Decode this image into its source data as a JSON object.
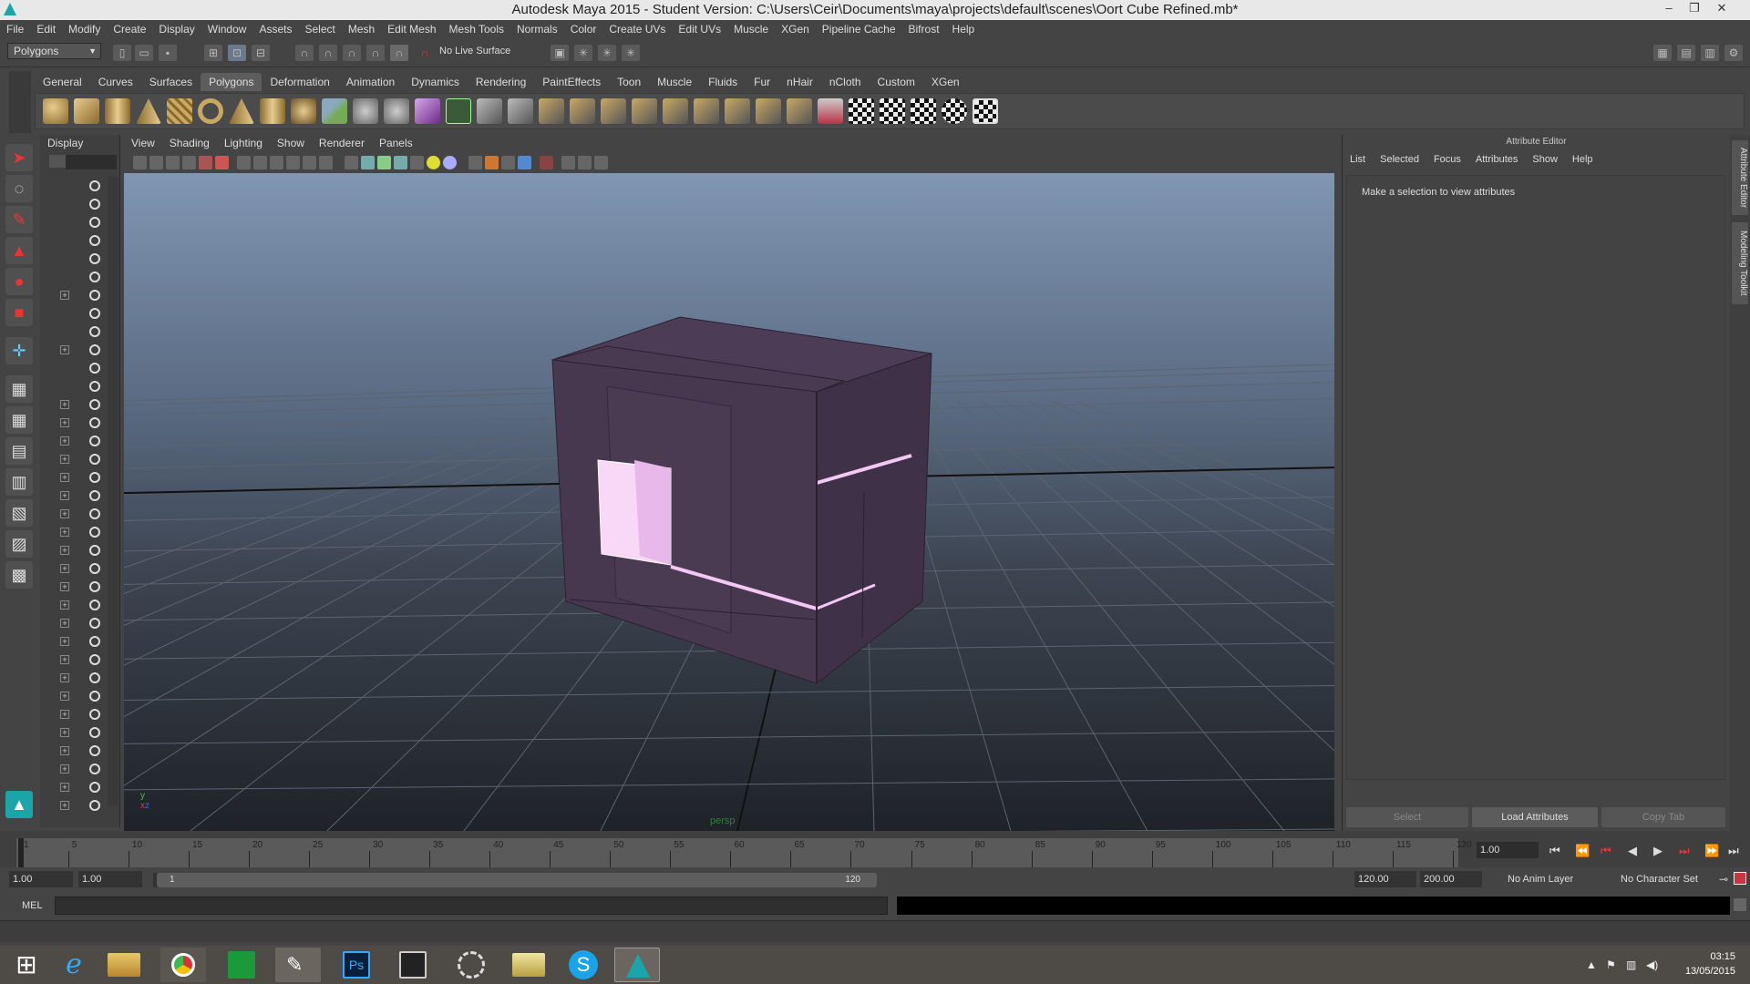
{
  "window": {
    "title": "Autodesk Maya 2015 - Student Version: C:\\Users\\Ceir\\Documents\\maya\\projects\\default\\scenes\\Oort Cube Refined.mb*",
    "minimize": "–",
    "restore": "❐",
    "close": "✕"
  },
  "menubar": [
    "File",
    "Edit",
    "Modify",
    "Create",
    "Display",
    "Window",
    "Assets",
    "Select",
    "Mesh",
    "Edit Mesh",
    "Mesh Tools",
    "Normals",
    "Color",
    "Create UVs",
    "Edit UVs",
    "Muscle",
    "XGen",
    "Pipeline Cache",
    "Bifrost",
    "Help"
  ],
  "status": {
    "mode": "Polygons",
    "live_surface": "No Live Surface"
  },
  "shelf": {
    "tabs": [
      "General",
      "Curves",
      "Surfaces",
      "Polygons",
      "Deformation",
      "Animation",
      "Dynamics",
      "Rendering",
      "PaintEffects",
      "Toon",
      "Muscle",
      "Fluids",
      "Fur",
      "nHair",
      "nCloth",
      "Custom",
      "XGen"
    ],
    "active_tab": "Polygons"
  },
  "outliner": {
    "header": "Display"
  },
  "panel": {
    "menus": [
      "View",
      "Shading",
      "Lighting",
      "Show",
      "Renderer",
      "Panels"
    ],
    "camera_label": "persp"
  },
  "attribute_editor": {
    "title": "Attribute Editor",
    "menus": [
      "List",
      "Selected",
      "Focus",
      "Attributes",
      "Show",
      "Help"
    ],
    "message": "Make a selection to view attributes",
    "buttons": {
      "select": "Select",
      "load": "Load Attributes",
      "copy": "Copy Tab"
    }
  },
  "side_tabs": [
    "Attribute Editor",
    "Modeling Toolkit"
  ],
  "time_slider": {
    "ticks": [
      "1",
      "5",
      "10",
      "15",
      "20",
      "25",
      "30",
      "35",
      "40",
      "45",
      "50",
      "55",
      "60",
      "65",
      "70",
      "75",
      "80",
      "85",
      "90",
      "95",
      "100",
      "105",
      "110",
      "115",
      "120"
    ],
    "current_frame": "1.00"
  },
  "range_slider": {
    "start": "1.00",
    "start2": "1.00",
    "range_start": "1",
    "range_end": "120",
    "end": "120.00",
    "end2": "200.00",
    "anim_layer": "No Anim Layer",
    "character_set": "No Character Set"
  },
  "command_line": {
    "label": "MEL"
  },
  "taskbar": {
    "time": "03:15",
    "date": "13/05/2015"
  },
  "colors": {
    "cube": "#4b3a52",
    "glow": "#f4c8f4",
    "accent": "#1aa6a8"
  }
}
